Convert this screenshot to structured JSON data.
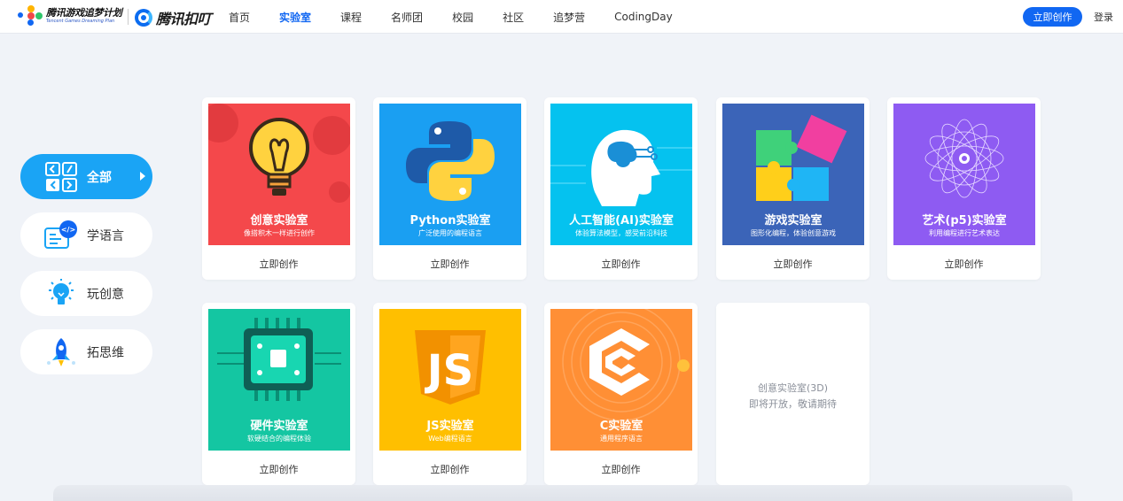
{
  "header": {
    "brand_title": "腾讯游戏追梦计划",
    "brand_subtitle": "Tencent Games Dreaming Plan",
    "product_name": "腾讯扣叮",
    "nav": [
      "首页",
      "实验室",
      "课程",
      "名师团",
      "校园",
      "社区",
      "追梦营",
      "CodingDay"
    ],
    "active_nav": "实验室",
    "create_button": "立即创作",
    "login": "登录",
    "accent": "#1167f2"
  },
  "sidebar": {
    "items": [
      {
        "label": "全部",
        "icon": "grid-icon"
      },
      {
        "label": "学语言",
        "icon": "code-bubble-icon"
      },
      {
        "label": "玩创意",
        "icon": "lightbulb-icon"
      },
      {
        "label": "拓思维",
        "icon": "rocket-icon"
      }
    ],
    "active": "全部"
  },
  "labs": [
    {
      "title": "创意实验室",
      "subtitle": "像搭积木一样进行创作",
      "action": "立即创作",
      "color": "#f4484b",
      "icon": "lightbulb-icon"
    },
    {
      "title": "Python实验室",
      "subtitle": "广泛使用的编程语言",
      "action": "立即创作",
      "color": "#1a9ff2",
      "icon": "python-icon"
    },
    {
      "title": "人工智能(AI)实验室",
      "subtitle": "体验算法模型，感受前沿科技",
      "action": "立即创作",
      "color": "#05c2ef",
      "icon": "ai-head-icon"
    },
    {
      "title": "游戏实验室",
      "subtitle": "图形化编程，体验创意游戏",
      "action": "立即创作",
      "color": "#3b64b8",
      "icon": "puzzle-icon"
    },
    {
      "title": "艺术(p5)实验室",
      "subtitle": "利用编程进行艺术表达",
      "action": "立即创作",
      "color": "#8e5bf2",
      "icon": "spirograph-icon"
    },
    {
      "title": "硬件实验室",
      "subtitle": "软硬结合的编程体验",
      "action": "立即创作",
      "color": "#14c6a2",
      "icon": "chip-icon"
    },
    {
      "title": "JS实验室",
      "subtitle": "Web编程语言",
      "action": "立即创作",
      "color": "#ffbf00",
      "icon": "js-shield-icon"
    },
    {
      "title": "C实验室",
      "subtitle": "通用程序语言",
      "action": "立即创作",
      "color": "#ff8f35",
      "icon": "c-hexagon-icon"
    }
  ],
  "placeholder": {
    "title": "创意实验室(3D)",
    "subtitle": "即将开放，敬请期待"
  }
}
